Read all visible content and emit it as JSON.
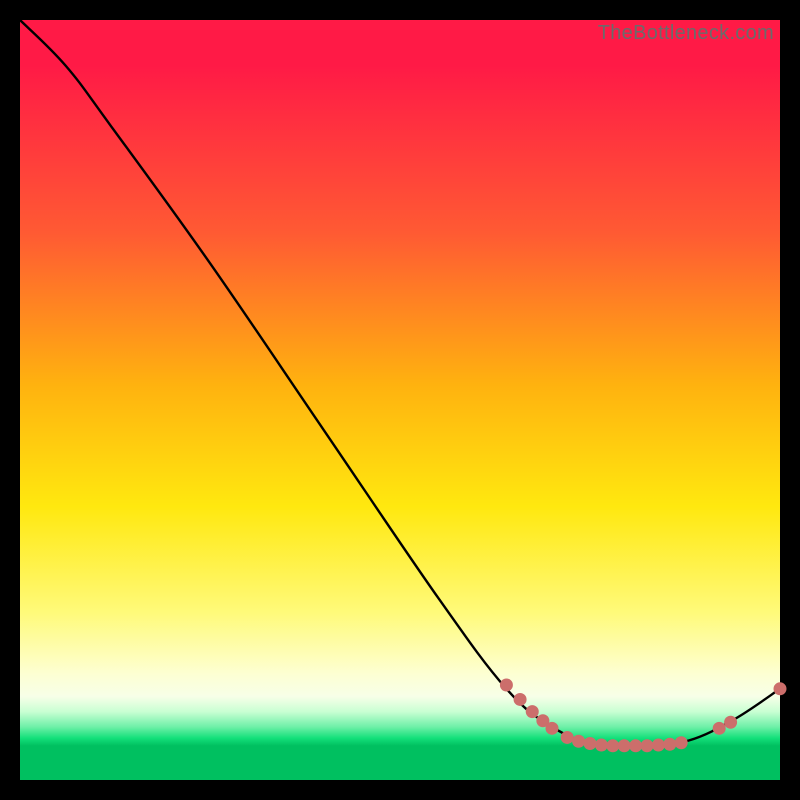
{
  "watermark": "TheBottleneck.com",
  "chart_data": {
    "type": "line",
    "title": "",
    "xlabel": "",
    "ylabel": "",
    "xlim": [
      0,
      100
    ],
    "ylim": [
      0,
      100
    ],
    "curve": [
      {
        "x": 0,
        "y": 100
      },
      {
        "x": 6,
        "y": 94
      },
      {
        "x": 12,
        "y": 86
      },
      {
        "x": 25,
        "y": 68
      },
      {
        "x": 40,
        "y": 46
      },
      {
        "x": 55,
        "y": 24
      },
      {
        "x": 64,
        "y": 12
      },
      {
        "x": 70,
        "y": 7
      },
      {
        "x": 76,
        "y": 4.5
      },
      {
        "x": 82,
        "y": 4.5
      },
      {
        "x": 88,
        "y": 5.2
      },
      {
        "x": 94,
        "y": 8
      },
      {
        "x": 100,
        "y": 12
      }
    ],
    "markers": [
      {
        "x": 64,
        "y": 12.5
      },
      {
        "x": 65.8,
        "y": 10.6
      },
      {
        "x": 67.4,
        "y": 9.0
      },
      {
        "x": 68.8,
        "y": 7.8
      },
      {
        "x": 70.0,
        "y": 6.8
      },
      {
        "x": 72.0,
        "y": 5.6
      },
      {
        "x": 73.5,
        "y": 5.1
      },
      {
        "x": 75.0,
        "y": 4.8
      },
      {
        "x": 76.5,
        "y": 4.6
      },
      {
        "x": 78.0,
        "y": 4.5
      },
      {
        "x": 79.5,
        "y": 4.5
      },
      {
        "x": 81.0,
        "y": 4.5
      },
      {
        "x": 82.5,
        "y": 4.5
      },
      {
        "x": 84.0,
        "y": 4.6
      },
      {
        "x": 85.5,
        "y": 4.7
      },
      {
        "x": 87.0,
        "y": 4.9
      },
      {
        "x": 92.0,
        "y": 6.8
      },
      {
        "x": 93.5,
        "y": 7.6
      },
      {
        "x": 100.0,
        "y": 12.0
      }
    ],
    "marker_color": "#cc6e6b",
    "line_color": "#000000"
  }
}
